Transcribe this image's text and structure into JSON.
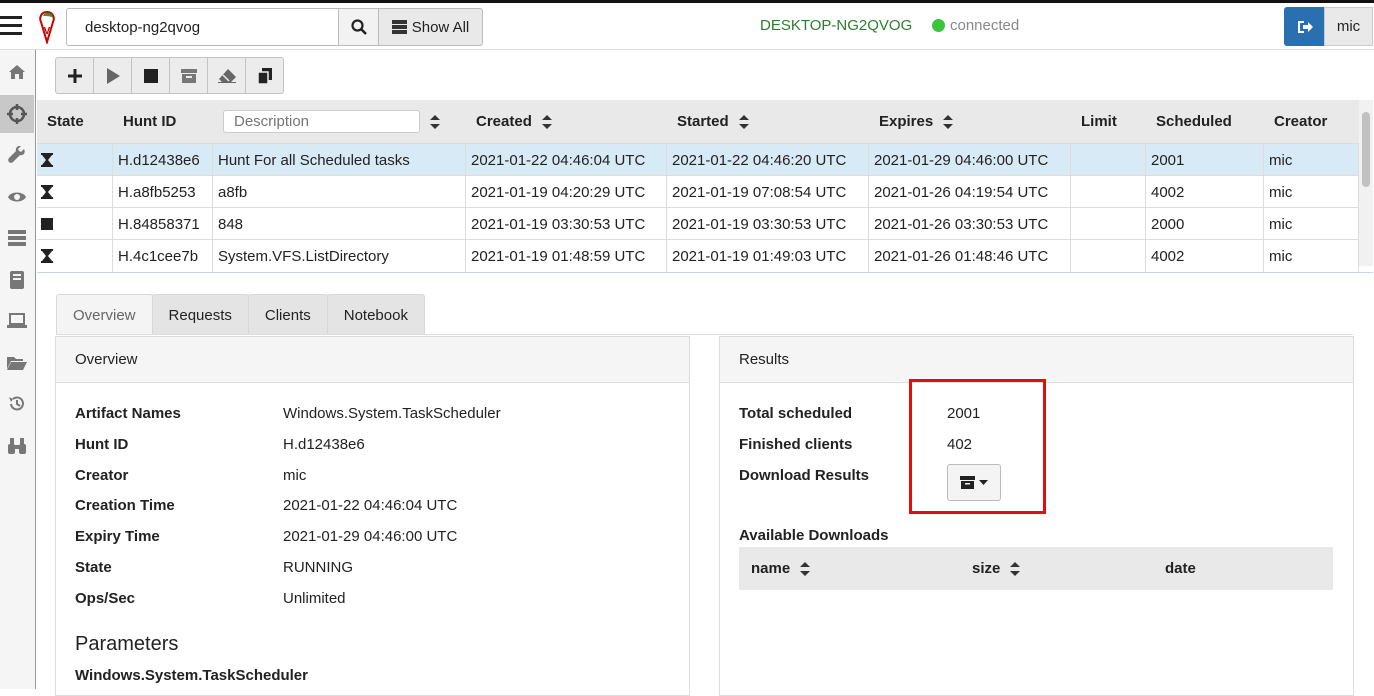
{
  "topbar": {
    "search_value": "desktop-ng2qvog",
    "show_all_label": "Show All",
    "hostname": "DESKTOP-NG2QVOG",
    "connection_status": "connected",
    "user": "mic"
  },
  "hunt_table": {
    "columns": [
      "State",
      "Hunt ID",
      "Description",
      "Created",
      "Started",
      "Expires",
      "Limit",
      "Scheduled",
      "Creator"
    ],
    "description_placeholder": "Description",
    "rows": [
      {
        "state": "running",
        "hunt_id": "H.d12438e6",
        "description": "Hunt For all Scheduled tasks",
        "created": "2021-01-22 04:46:04 UTC",
        "started": "2021-01-22 04:46:20 UTC",
        "expires": "2021-01-29 04:46:00 UTC",
        "limit": "",
        "scheduled": "2001",
        "creator": "mic"
      },
      {
        "state": "running",
        "hunt_id": "H.a8fb5253",
        "description": "a8fb",
        "created": "2021-01-19 04:20:29 UTC",
        "started": "2021-01-19 07:08:54 UTC",
        "expires": "2021-01-26 04:19:54 UTC",
        "limit": "",
        "scheduled": "4002",
        "creator": "mic"
      },
      {
        "state": "stopped",
        "hunt_id": "H.84858371",
        "description": "848",
        "created": "2021-01-19 03:30:53 UTC",
        "started": "2021-01-19 03:30:53 UTC",
        "expires": "2021-01-26 03:30:53 UTC",
        "limit": "",
        "scheduled": "2000",
        "creator": "mic"
      },
      {
        "state": "running",
        "hunt_id": "H.4c1cee7b",
        "description": "System.VFS.ListDirectory",
        "created": "2021-01-19 01:48:59 UTC",
        "started": "2021-01-19 01:49:03 UTC",
        "expires": "2021-01-26 01:48:46 UTC",
        "limit": "",
        "scheduled": "4002",
        "creator": "mic"
      }
    ]
  },
  "tabs": [
    "Overview",
    "Requests",
    "Clients",
    "Notebook"
  ],
  "overview": {
    "title": "Overview",
    "fields": [
      {
        "k": "Artifact Names",
        "v": "Windows.System.TaskScheduler"
      },
      {
        "k": "Hunt ID",
        "v": "H.d12438e6"
      },
      {
        "k": "Creator",
        "v": "mic"
      },
      {
        "k": "Creation Time",
        "v": "2021-01-22 04:46:04 UTC"
      },
      {
        "k": "Expiry Time",
        "v": "2021-01-29 04:46:00 UTC"
      },
      {
        "k": "State",
        "v": "RUNNING"
      },
      {
        "k": "Ops/Sec",
        "v": "Unlimited"
      }
    ],
    "parameters_heading": "Parameters",
    "parameters_artifact": "Windows.System.TaskScheduler"
  },
  "results": {
    "title": "Results",
    "total_scheduled_label": "Total scheduled",
    "total_scheduled": "2001",
    "finished_clients_label": "Finished clients",
    "finished_clients": "402",
    "download_results_label": "Download Results",
    "available_downloads_label": "Available Downloads",
    "downloads_columns": [
      "name",
      "size",
      "date"
    ]
  },
  "colors": {
    "accent": "#2a6fb0",
    "connected": "#3cc43c",
    "hostname": "#2e7d2e",
    "highlight_box": "#e01010",
    "selected_row": "#d9eaf7"
  }
}
